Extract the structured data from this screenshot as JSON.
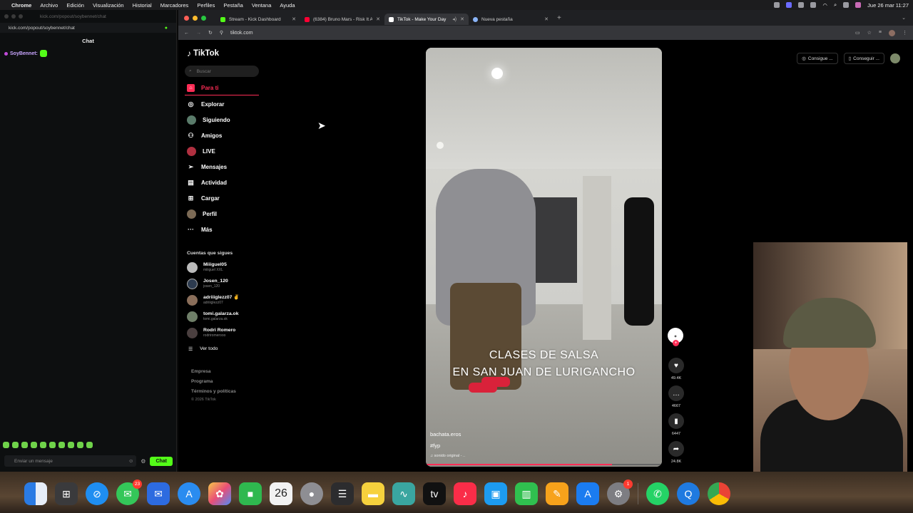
{
  "menubar": {
    "apple": "",
    "app": "Chrome",
    "items": [
      "Archivo",
      "Edición",
      "Visualización",
      "Historial",
      "Marcadores",
      "Perfiles",
      "Pestaña",
      "Ventana",
      "Ayuda"
    ],
    "clock": "Jue 26 mar 11:27"
  },
  "chat_window": {
    "title": "kick.com/popout/soybennet/chat",
    "url": "kick.com/popout/soybennet/chat",
    "header": "Chat",
    "messages": [
      {
        "user": "SoyBennet:"
      }
    ],
    "input_placeholder": "Enviar un mensaje",
    "send_label": "Chat",
    "accent": "#53fc18"
  },
  "browser": {
    "tabs": [
      {
        "title": "Stream - Kick Dashboard",
        "active": false,
        "fav": "#53fc18"
      },
      {
        "title": "(6384) Bruno Mars - Risk It All",
        "active": false,
        "fav": "#ff0033"
      },
      {
        "title": "TikTok - Make Your Day",
        "active": true,
        "fav": "#ffffff"
      },
      {
        "title": "Nueva pestaña",
        "active": false,
        "fav": "#8ab4f8"
      }
    ],
    "url": "tiktok.com"
  },
  "tiktok": {
    "logo": "TikTok",
    "search_placeholder": "Buscar",
    "nav": [
      {
        "label": "Para ti",
        "icon": "home-icon"
      },
      {
        "label": "Explorar",
        "icon": "compass-icon"
      },
      {
        "label": "Siguiendo",
        "icon": "following-icon"
      },
      {
        "label": "Amigos",
        "icon": "friends-icon"
      },
      {
        "label": "LIVE",
        "icon": "live-icon"
      },
      {
        "label": "Mensajes",
        "icon": "messages-icon"
      },
      {
        "label": "Actividad",
        "icon": "activity-icon"
      },
      {
        "label": "Cargar",
        "icon": "upload-icon"
      },
      {
        "label": "Perfil",
        "icon": "profile-icon"
      },
      {
        "label": "Más",
        "icon": "more-icon"
      }
    ],
    "following_header": "Cuentas que sigues",
    "accounts": [
      {
        "name": "Miiiguel05",
        "handle": "miiiguel XXL"
      },
      {
        "name": "Josen_120",
        "handle": "josen_120"
      },
      {
        "name": "adriiiglezz07 ✌",
        "handle": "adriiiglezz07"
      },
      {
        "name": "tomi.galarza.ok",
        "handle": "tomi.galarza.ok"
      },
      {
        "name": "Rodri Romero",
        "handle": "rodriromerooo"
      }
    ],
    "see_all": "Ver todo",
    "footer": [
      "Empresa",
      "Programa",
      "Términos y políticas"
    ],
    "copyright": "© 2026 TikTok",
    "top_right": [
      "Consigue ...",
      "Conseguir ..."
    ],
    "video": {
      "caption_line1": "CLASES DE SALSA",
      "caption_line2": "EN SAN JUAN DE LURIGANCHO",
      "user": "bachata.eros",
      "tag": "#fyp",
      "sound": "♫ sonido original - ..",
      "progress": 0.79
    },
    "actions": {
      "likes": "49.4K",
      "comments": "4667",
      "saves": "6447",
      "shares": "24.8K"
    }
  },
  "dock": {
    "messages_badge": "23",
    "calendar_day": "26",
    "settings_badge": "1"
  }
}
